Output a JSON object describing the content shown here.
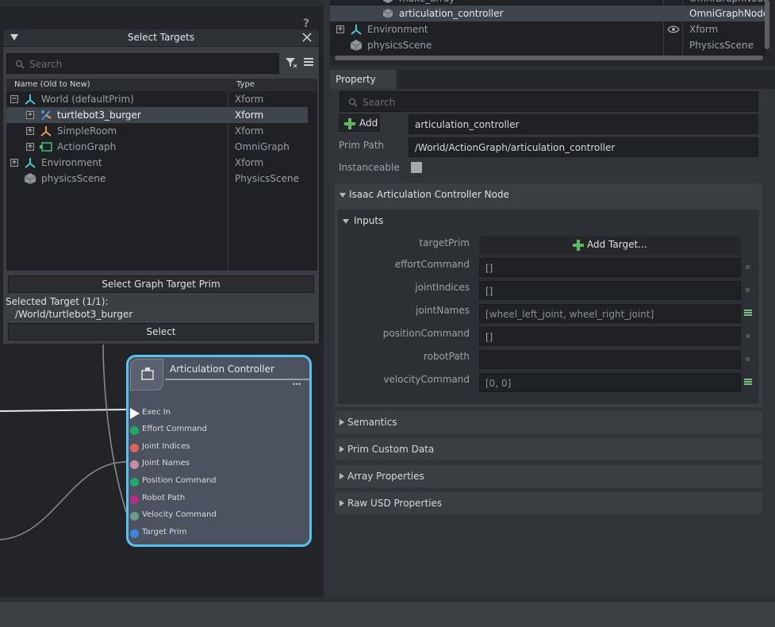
{
  "select_targets": {
    "title": "Select Targets",
    "search_placeholder": "Search",
    "col_name": "Name (Old to New)",
    "col_type": "Type",
    "rows": [
      {
        "name": "World (defaultPrim)",
        "type": "Xform"
      },
      {
        "name": "turtlebot3_burger",
        "type": "Xform"
      },
      {
        "name": "SimpleRoom",
        "type": "Xform"
      },
      {
        "name": "ActionGraph",
        "type": "OmniGraph"
      },
      {
        "name": "Environment",
        "type": "Xform"
      },
      {
        "name": "physicsScene",
        "type": "PhysicsScene"
      }
    ],
    "select_graph_target_label": "Select Graph Target Prim",
    "selected_target_label": "Selected Target (1/1):",
    "selected_target_path": "/World/turtlebot3_burger",
    "select_label": "Select",
    "help_glyph": "?"
  },
  "node": {
    "title": "Articulation Controller",
    "more_glyph": "•••",
    "ports": [
      {
        "label": "Exec In",
        "color": "#ffffff"
      },
      {
        "label": "Effort Command",
        "color": "#1faa6a"
      },
      {
        "label": "Joint Indices",
        "color": "#e0635a"
      },
      {
        "label": "Joint Names",
        "color": "#c48fa5"
      },
      {
        "label": "Position Command",
        "color": "#1faa6a"
      },
      {
        "label": "Robot Path",
        "color": "#b42d8b"
      },
      {
        "label": "Velocity Command",
        "color": "#6e9c88"
      },
      {
        "label": "Target Prim",
        "color": "#3b86d8"
      }
    ]
  },
  "stage": {
    "rows": [
      {
        "name": "make_array",
        "type": "OmniGraphNode"
      },
      {
        "name": "articulation_controller",
        "type": "OmniGraphNode"
      },
      {
        "name": "Environment",
        "type": "Xform"
      },
      {
        "name": "physicsScene",
        "type": "PhysicsScene"
      }
    ]
  },
  "property": {
    "tab_label": "Property",
    "search_placeholder": "Search",
    "add_label": "Add",
    "name_value": "articulation_controller",
    "prim_path_label": "Prim Path",
    "prim_path_value": "/World/ActionGraph/articulation_controller",
    "instanceable_label": "Instanceable",
    "section_node_title": "Isaac Articulation Controller Node",
    "inputs_title": "Inputs",
    "inputs": [
      {
        "label": "targetPrim",
        "value": "Add Target..."
      },
      {
        "label": "effortCommand",
        "value": "[]"
      },
      {
        "label": "jointIndices",
        "value": "[]"
      },
      {
        "label": "jointNames",
        "value": "[wheel_left_joint, wheel_right_joint]"
      },
      {
        "label": "positionCommand",
        "value": "[]"
      },
      {
        "label": "robotPath",
        "value": ""
      },
      {
        "label": "velocityCommand",
        "value": "[0, 0]"
      }
    ],
    "sections": [
      "Semantics",
      "Prim Custom Data",
      "Array Properties",
      "Raw USD Properties"
    ]
  },
  "colors": {
    "node_border": "#56c1f2",
    "accent_green": "#77c27c",
    "selection": "#3f454c"
  }
}
